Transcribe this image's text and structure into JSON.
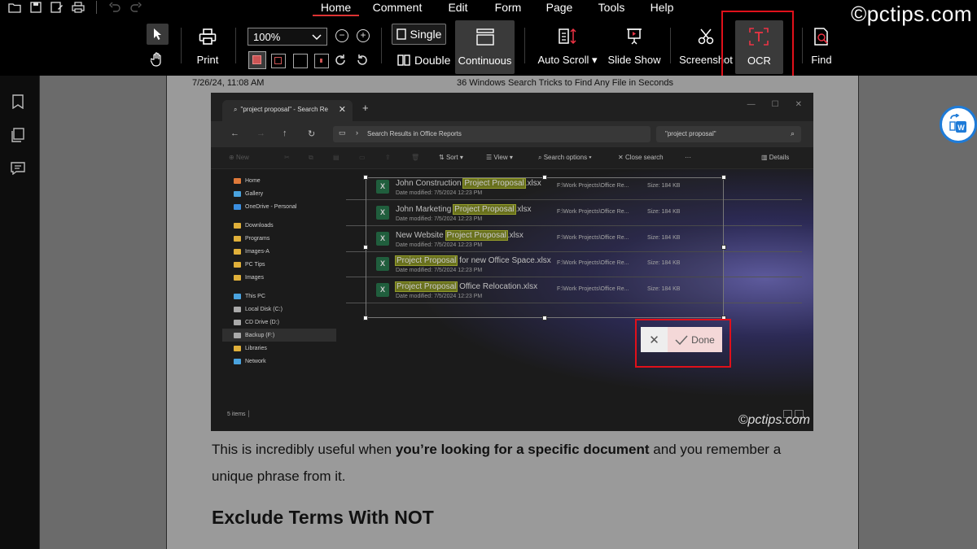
{
  "menu": [
    "Home",
    "Comment",
    "Edit",
    "Form",
    "Page",
    "Tools",
    "Help"
  ],
  "menu_active": "Home",
  "brand_watermark": "©pctips.com",
  "toolbar": {
    "print": "Print",
    "zoom": "100%",
    "single": "Single",
    "double": "Double",
    "continuous": "Continuous",
    "auto_scroll": "Auto Scroll",
    "slide_show": "Slide Show",
    "screenshot": "Screenshot",
    "ocr": "OCR",
    "find": "Find"
  },
  "page": {
    "header_date": "7/26/24, 11:08 AM",
    "header_title": "36 Windows Search Tricks to Find Any File in Seconds",
    "para_start": "This is incredibly useful when ",
    "para_bold": "you’re looking for a specific document",
    "para_end": " and you remember a unique phrase from it.",
    "heading": "Exclude Terms With NOT"
  },
  "explorer": {
    "tab_title": "\"project proposal\" - Search Re",
    "address": "Search Results in Office Reports",
    "search": "\"project proposal\"",
    "commands": {
      "new": "New",
      "sort": "Sort",
      "view": "View",
      "search_options": "Search options",
      "close_search": "Close search",
      "more": "···",
      "details": "Details"
    },
    "nav": [
      {
        "label": "Home",
        "color": "#e07a3a"
      },
      {
        "label": "Gallery",
        "color": "#4aa3df"
      },
      {
        "label": "OneDrive - Personal",
        "color": "#3b8fe0"
      },
      {
        "label": "Downloads",
        "color": "#e0b03a"
      },
      {
        "label": "Programs",
        "color": "#e0b03a"
      },
      {
        "label": "Images-A",
        "color": "#e0b03a"
      },
      {
        "label": "PC Tips",
        "color": "#e0b03a"
      },
      {
        "label": "Images",
        "color": "#e0b03a"
      },
      {
        "label": "This PC",
        "color": "#4aa3df"
      },
      {
        "label": "Local Disk (C:)",
        "color": "#aaaaaa"
      },
      {
        "label": "CD Drive (D:)",
        "color": "#aaaaaa"
      },
      {
        "label": "Backup (F:)",
        "color": "#aaaaaa"
      },
      {
        "label": "Libraries",
        "color": "#e0b03a"
      },
      {
        "label": "Network",
        "color": "#4aa3df"
      }
    ],
    "files": [
      {
        "pre": "John Construction ",
        "hl": "Project Proposal",
        "post": ".xlsx",
        "date": "Date modified: 7/5/2024 12:23 PM",
        "path": "F:\\Work Projects\\Office Re...",
        "size": "Size: 184 KB"
      },
      {
        "pre": "John Marketing ",
        "hl": "Project Proposal",
        "post": ".xlsx",
        "date": "Date modified: 7/5/2024 12:23 PM",
        "path": "F:\\Work Projects\\Office Re...",
        "size": "Size: 184 KB"
      },
      {
        "pre": "New Website ",
        "hl": "Project Proposal",
        "post": ".xlsx",
        "date": "Date modified: 7/5/2024 12:23 PM",
        "path": "F:\\Work Projects\\Office Re...",
        "size": "Size: 184 KB"
      },
      {
        "pre": "",
        "hl": "Project Proposal",
        "post": " for new Office Space.xlsx",
        "date": "Date modified: 7/5/2024 12:23 PM",
        "path": "F:\\Work Projects\\Office Re...",
        "size": "Size: 184 KB"
      },
      {
        "pre": "",
        "hl": "Project Proposal",
        "post": " Office Relocation.xlsx",
        "date": "Date modified: 7/5/2024 12:23 PM",
        "path": "F:\\Work Projects\\Office Re...",
        "size": "Size: 184 KB"
      }
    ],
    "status": "5 items",
    "watermark": "©pctips.com"
  },
  "ocr_popup": {
    "cancel": "✕",
    "done": "Done"
  },
  "colors": {
    "accent_red": "#e0101a",
    "highlight": "#7f8a1a",
    "convert_blue": "#1e7bd8"
  }
}
